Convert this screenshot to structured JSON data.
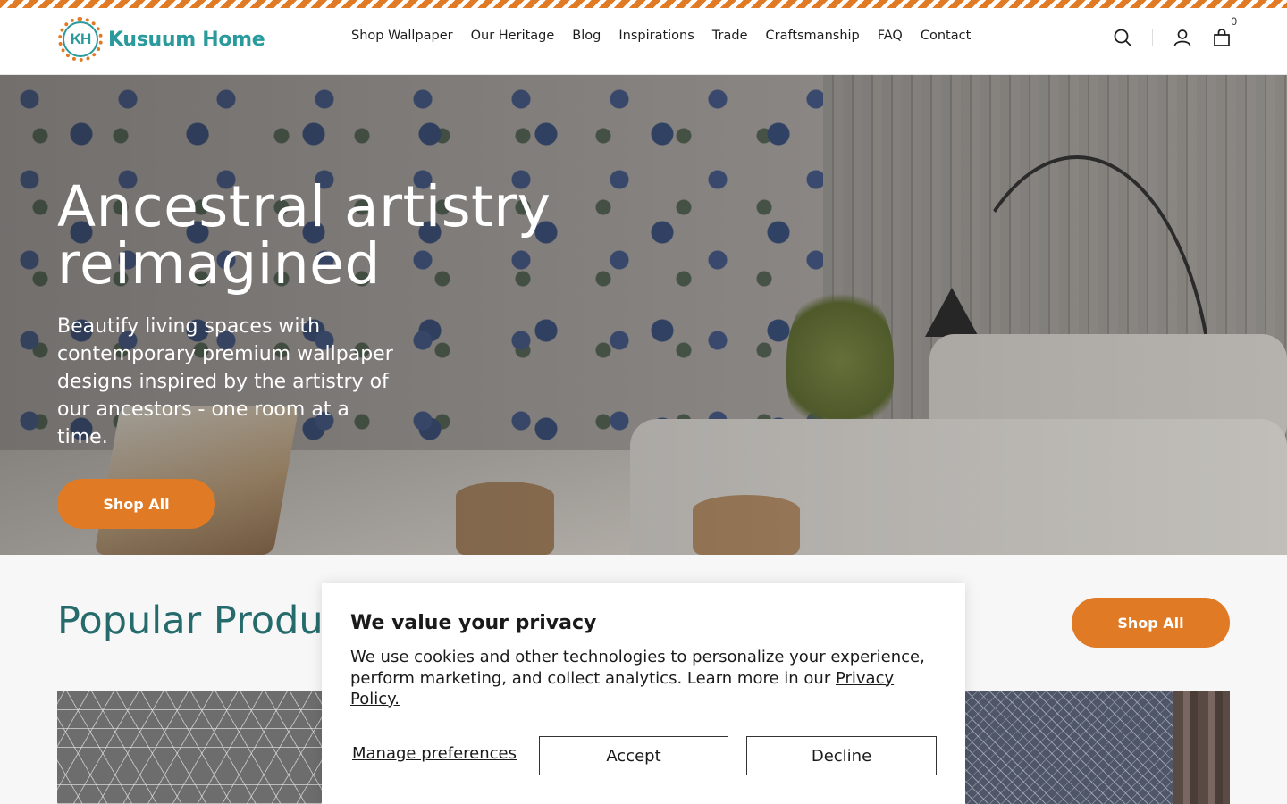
{
  "brand": {
    "logo_mark": "KH",
    "name": "Kusuum Home",
    "primary_color": "#e07a24",
    "teal_color": "#2a9a9c"
  },
  "nav": {
    "items": [
      {
        "label": "Shop Wallpaper"
      },
      {
        "label": "Our Heritage"
      },
      {
        "label": "Blog"
      },
      {
        "label": "Inspirations"
      },
      {
        "label": "Trade"
      },
      {
        "label": "Craftsmanship"
      },
      {
        "label": "FAQ"
      },
      {
        "label": "Contact"
      }
    ]
  },
  "header_icons": {
    "search": "search-icon",
    "account": "user-icon",
    "cart": "shopping-bag-icon",
    "cart_count": "0"
  },
  "hero": {
    "title": "Ancestral artistry reimagined",
    "subtitle": "Beautify living spaces with contemporary premium wallpaper designs inspired by the artistry of our ancestors - one room at a time.",
    "cta_label": "Shop All",
    "slides_total": 3,
    "active_slide": 1
  },
  "popular": {
    "title": "Popular Products",
    "cta_label": "Shop All"
  },
  "cookie": {
    "heading": "We value your privacy",
    "body": "We use cookies and other technologies to personalize your experience, perform marketing, and collect analytics. Learn more in our ",
    "link": "Privacy Policy.",
    "manage_label": "Manage preferences",
    "accept_label": "Accept",
    "decline_label": "Decline"
  }
}
